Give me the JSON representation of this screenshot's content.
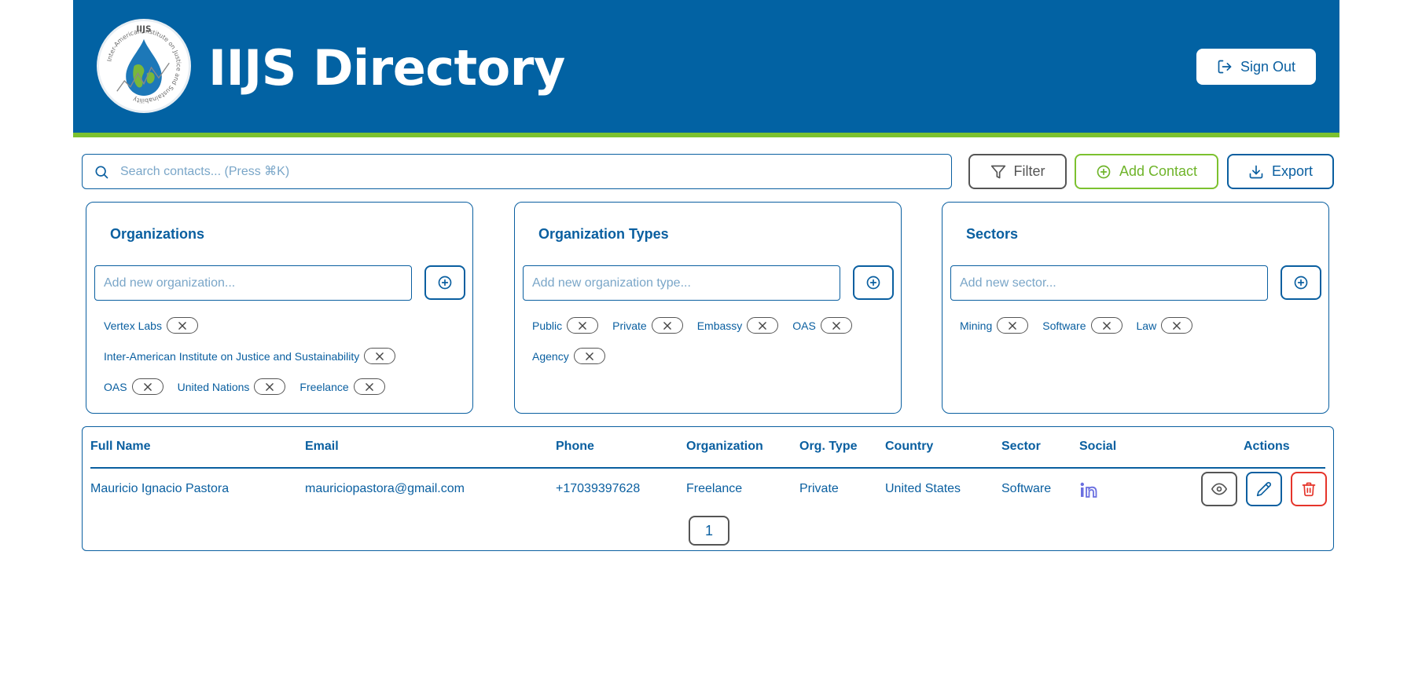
{
  "header": {
    "title": "IIJS Directory",
    "logo_text": "IIJS",
    "logo_ring_text": "Inter-American Institute on Justice and Sustainability",
    "sign_out_label": "Sign Out",
    "brand_color": "#0262a3",
    "accent_color": "#7cc12f"
  },
  "toolbar": {
    "search_placeholder": "Search contacts... (Press ⌘K)",
    "search_value": "",
    "filter_label": "Filter",
    "add_contact_label": "Add Contact",
    "export_label": "Export"
  },
  "panels": {
    "organizations": {
      "title": "Organizations",
      "placeholder": "Add new organization...",
      "items": [
        "Vertex Labs",
        "Inter-American Institute on Justice and Sustainability",
        "OAS",
        "United Nations",
        "Freelance"
      ]
    },
    "org_types": {
      "title": "Organization Types",
      "placeholder": "Add new organization type...",
      "items": [
        "Public",
        "Private",
        "Embassy",
        "OAS",
        "Agency"
      ]
    },
    "sectors": {
      "title": "Sectors",
      "placeholder": "Add new sector...",
      "items": [
        "Mining",
        "Software",
        "Law"
      ]
    }
  },
  "table": {
    "columns": [
      "Full Name",
      "Email",
      "Phone",
      "Organization",
      "Org. Type",
      "Country",
      "Sector",
      "Social",
      "Actions"
    ],
    "rows": [
      {
        "full_name": "Mauricio Ignacio Pastora",
        "email": "mauriciopastora@gmail.com",
        "phone": "+17039397628",
        "organization": "Freelance",
        "org_type": "Private",
        "country": "United States",
        "sector": "Software",
        "social": "linkedin-icon"
      }
    ],
    "pagination": {
      "current_page": "1"
    }
  }
}
